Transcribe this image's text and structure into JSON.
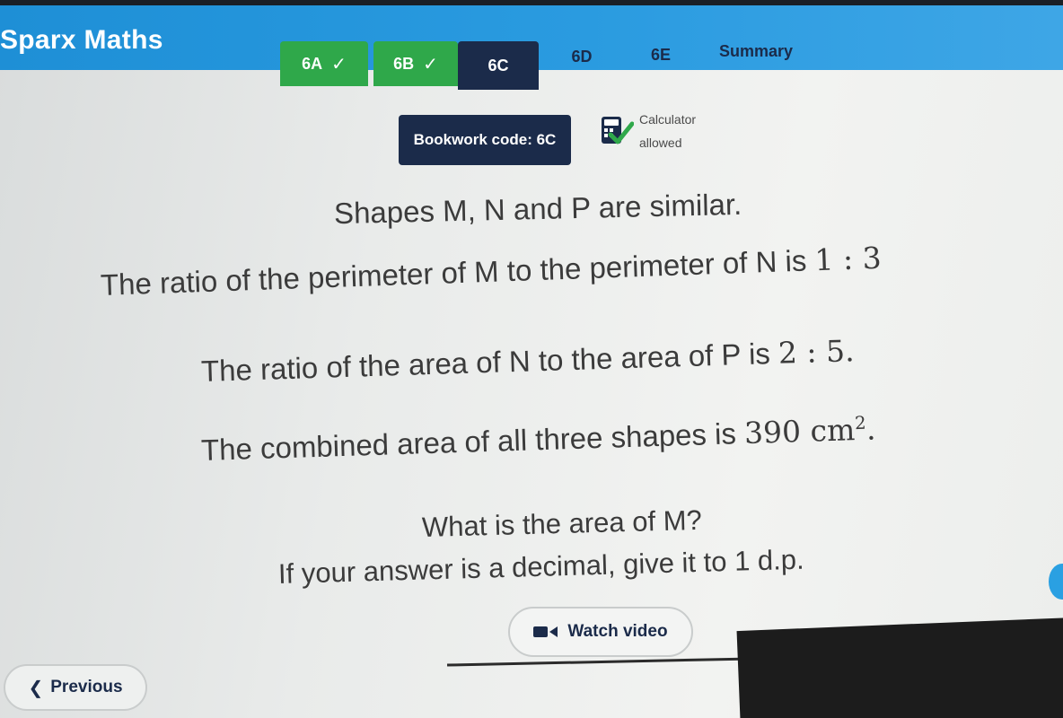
{
  "app": {
    "title": "Sparx Maths"
  },
  "tabs": [
    {
      "label": "6A",
      "state": "done",
      "check": "✓"
    },
    {
      "label": "6B",
      "state": "done",
      "check": "✓"
    },
    {
      "label": "6C",
      "state": "current"
    },
    {
      "label": "6D",
      "state": "pending"
    },
    {
      "label": "6E",
      "state": "pending"
    },
    {
      "label": "Summary",
      "state": "pending"
    }
  ],
  "bookwork": {
    "label": "Bookwork code: 6C"
  },
  "calculator": {
    "line1": "Calculator",
    "line2": "allowed",
    "icon": "calculator-check-icon"
  },
  "question": {
    "line1": "Shapes M, N and P are similar.",
    "line2_text": "The ratio of the perimeter of M to the perimeter of N is",
    "line2_ratio": "1 : 3",
    "line3_text": "The ratio of the area of N to the area of P is",
    "line3_ratio": "2 : 5.",
    "line4_text": "The combined area of all three shapes is",
    "line4_value": "390",
    "line4_unit": "cm",
    "line4_exp": "2",
    "line4_end": ".",
    "line5": "What is the area of M?",
    "line6": "If your answer is a decimal, give it to 1 d.p."
  },
  "buttons": {
    "watch_video": "Watch video",
    "previous": "Previous"
  },
  "colors": {
    "header_blue": "#1e8fd6",
    "tab_done_green": "#2fa84a",
    "navy": "#1b2b4a"
  }
}
